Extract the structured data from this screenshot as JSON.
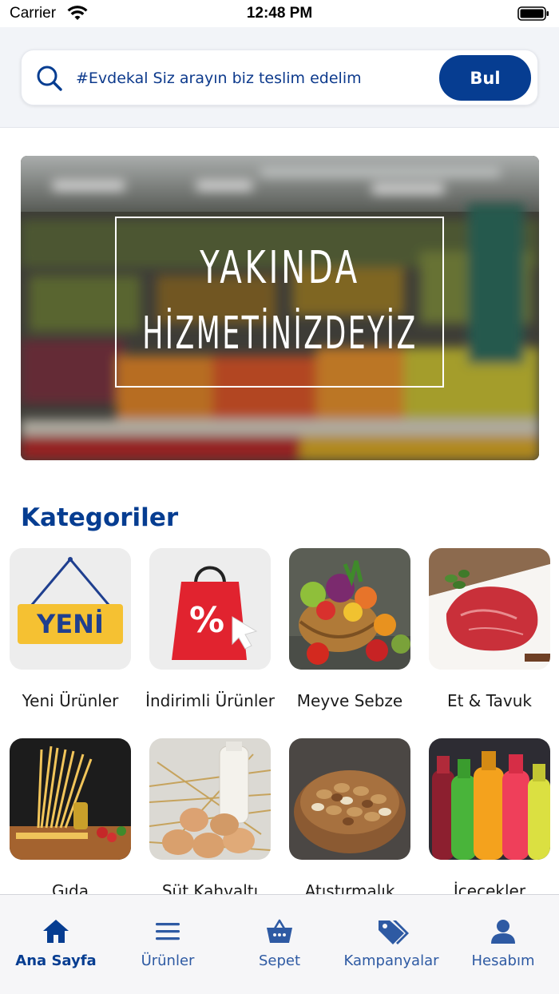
{
  "status_bar": {
    "carrier": "Carrier",
    "time": "12:48 PM"
  },
  "search": {
    "placeholder": "#Evdekal Siz arayın biz teslim edelim",
    "value": "",
    "button_label": "Bul"
  },
  "banner": {
    "line1": "YAKINDA",
    "line2": "HİZMETİNİZDEYİZ"
  },
  "categories": {
    "title": "Kategoriler",
    "items": [
      {
        "label": "Yeni Ürünler",
        "badge_text": "YENİ",
        "icon": "new-sign-icon"
      },
      {
        "label": "İndirimli Ürünler",
        "badge_text": "%",
        "icon": "discount-bag-icon"
      },
      {
        "label": "Meyve Sebze",
        "icon": "fruit-basket-image"
      },
      {
        "label": "Et & Tavuk",
        "icon": "meat-image"
      },
      {
        "label": "Gıda",
        "icon": "pasta-image"
      },
      {
        "label": "Süt Kahvaltı",
        "icon": "eggs-milk-image"
      },
      {
        "label": "Atıştırmalık",
        "icon": "nuts-image"
      },
      {
        "label": "İçecekler",
        "icon": "soda-bottles-image"
      }
    ]
  },
  "tabs": [
    {
      "label": "Ana Sayfa",
      "icon": "home-icon",
      "active": true
    },
    {
      "label": "Ürünler",
      "icon": "menu-icon",
      "active": false
    },
    {
      "label": "Sepet",
      "icon": "basket-icon",
      "active": false
    },
    {
      "label": "Kampanyalar",
      "icon": "tags-icon",
      "active": false
    },
    {
      "label": "Hesabım",
      "icon": "user-icon",
      "active": false
    }
  ],
  "colors": {
    "brand": "#063d91",
    "tab_inactive": "#2e5aa3",
    "search_bg": "#f2f4f8"
  }
}
